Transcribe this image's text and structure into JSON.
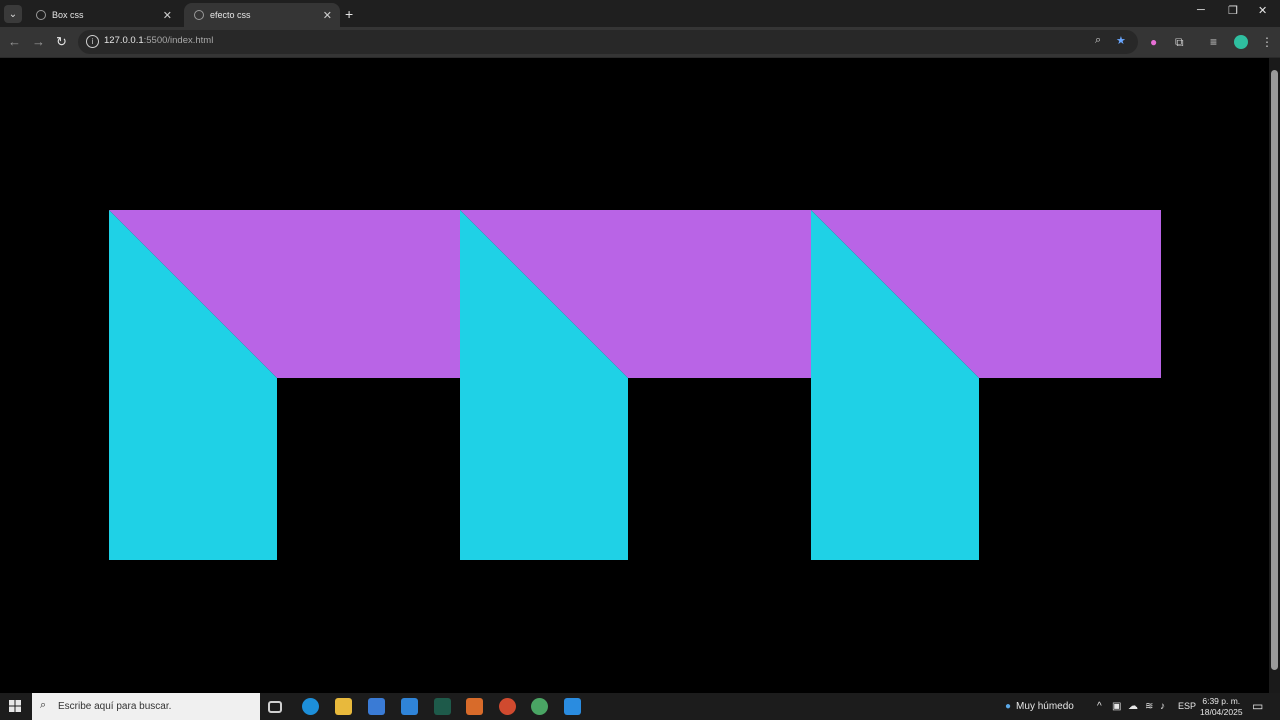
{
  "browser": {
    "tabs": [
      {
        "title": "Box css",
        "active": false
      },
      {
        "title": "efecto css",
        "active": true
      }
    ],
    "address": {
      "host": "127.0.0.1",
      "rest": ":5500/index.html"
    }
  },
  "shapes": {
    "colors": {
      "background": "#000000",
      "top": "#b964e6",
      "legs": "#1fd1e6"
    },
    "count": 3
  },
  "taskbar": {
    "search_placeholder": "Escribe aquí para buscar.",
    "weather": "Muy húmedo",
    "language": "ESP",
    "time": "6:39 p. m.",
    "date": "18/04/2025"
  }
}
